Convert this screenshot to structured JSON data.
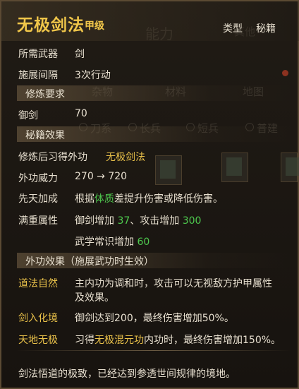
{
  "header": {
    "title": "无极剑法",
    "grade": "甲级",
    "type_label": "类型",
    "type_value": "秘籍"
  },
  "info": {
    "weapon_label": "所需武器",
    "weapon_value": "剑",
    "interval_label": "施展间隔",
    "interval_value": "3次行动"
  },
  "requirements": {
    "section_title": "修炼要求",
    "skill_label": "御剑",
    "skill_value": "70"
  },
  "effects": {
    "section_title": "秘籍效果",
    "learn_label": "修炼后习得外功",
    "learn_value": "无极剑法",
    "power_label": "外功威力",
    "power_value": "270 → 720",
    "innate_label": "先天加成",
    "innate_pre": "根据",
    "innate_attr": "体质",
    "innate_post": "差提升伤害或降低伤害。",
    "stack_label": "满重属性",
    "stack_line1_a": "御剑增加",
    "stack_line1_b": "37",
    "stack_line1_c": "、攻击增加",
    "stack_line1_d": "300",
    "stack_line2_a": "武学常识增加",
    "stack_line2_b": "60"
  },
  "external": {
    "section_title": "外功效果（施展武功时生效）",
    "e1_label": "道法自然",
    "e1_text_a": "主内功为调和时，攻击可以无视敌方护甲属性",
    "e1_text_b": "及效果。",
    "e2_label": "剑入化境",
    "e2_text": "御剑达到200，最终伤害增加50%。",
    "e3_label": "天地无极",
    "e3_text_a": "习得",
    "e3_text_b": "无极混元功",
    "e3_text_c": "内功时，最终伤害增加150%。"
  },
  "flavor": "剑法悟道的极致，已经达到参透世间规律的境地。",
  "background": {
    "tab_ability": "能力",
    "tab_other": "其他",
    "tab_items": "杂物",
    "tab_materials": "材料",
    "tab_map": "地图",
    "filter_1": "刀系",
    "filter_2": "长兵",
    "filter_3": "短兵",
    "filter_4": "普建"
  }
}
